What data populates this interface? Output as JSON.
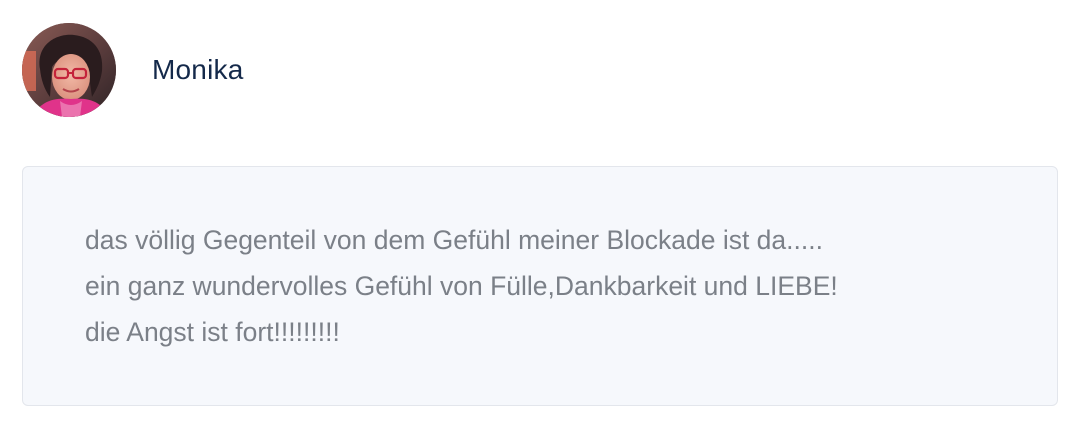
{
  "comment": {
    "author": {
      "name": "Monika",
      "avatar_icon": "user-photo"
    },
    "body": {
      "lines": [
        "das völlig Gegenteil von dem Gefühl meiner Blockade ist da.....",
        "ein ganz wundervolles Gefühl von Fülle,Dankbarkeit und LIEBE!",
        "die Angst ist fort!!!!!!!!!"
      ]
    }
  },
  "colors": {
    "author_name": "#14294a",
    "body_text": "#7b8088",
    "bubble_background": "#f6f8fc",
    "bubble_border": "#e3e6ec"
  }
}
